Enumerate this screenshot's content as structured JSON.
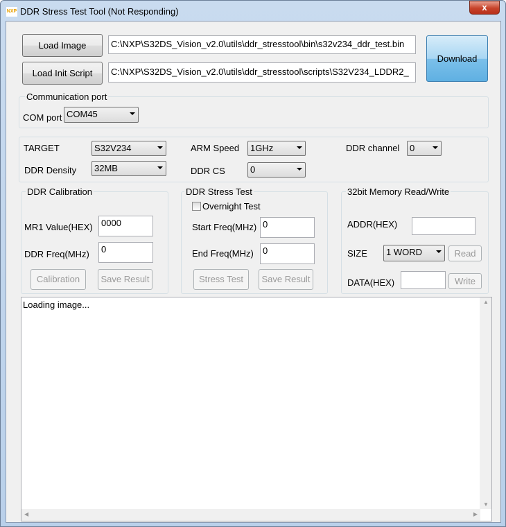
{
  "window": {
    "title": "DDR Stress Test Tool (Not Responding)",
    "logo": "NXP",
    "close": "x"
  },
  "files": {
    "load_image": "Load Image",
    "load_script": "Load Init Script",
    "image_path": "C:\\NXP\\S32DS_Vision_v2.0\\utils\\ddr_stresstool\\bin\\s32v234_ddr_test.bin",
    "script_path": "C:\\NXP\\S32DS_Vision_v2.0\\utils\\ddr_stresstool\\scripts\\S32V234_LDDR2_",
    "download": "Download"
  },
  "comm": {
    "group": "Communication port",
    "label": "COM port",
    "value": "COM45"
  },
  "config": {
    "target_label": "TARGET",
    "target": "S32V234",
    "density_label": "DDR Density",
    "density": "32MB",
    "arm_label": "ARM Speed",
    "arm": "1GHz",
    "cs_label": "DDR CS",
    "cs": "0",
    "channel_label": "DDR channel",
    "channel": "0"
  },
  "calib": {
    "group": "DDR Calibration",
    "mr1_label": "MR1 Value(HEX)",
    "mr1": "0000",
    "freq_label": "DDR Freq(MHz)",
    "freq": "0",
    "calibration": "Calibration",
    "save": "Save Result"
  },
  "stress": {
    "group": "DDR Stress Test",
    "overnight": "Overnight Test",
    "start_label": "Start Freq(MHz)",
    "start": "0",
    "end_label": "End Freq(MHz)",
    "end": "0",
    "stress_btn": "Stress Test",
    "save": "Save Result"
  },
  "mem": {
    "group": "32bit Memory Read/Write",
    "addr_label": "ADDR(HEX)",
    "addr": "",
    "size_label": "SIZE",
    "size": "1 WORD",
    "read": "Read",
    "data_label": "DATA(HEX)",
    "data": "",
    "write": "Write"
  },
  "log": {
    "text": "Loading image..."
  }
}
